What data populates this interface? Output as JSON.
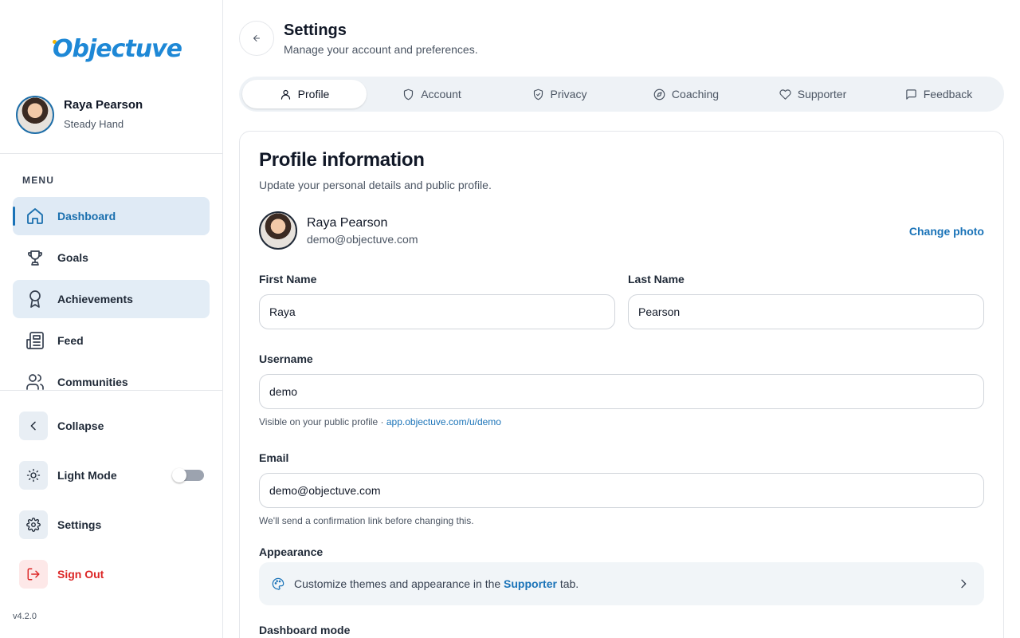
{
  "sidebar": {
    "logo": "Objectuve",
    "user": {
      "name": "Raya Pearson",
      "title": "Steady Hand"
    },
    "menu_label": "MENU",
    "items": [
      {
        "label": "Dashboard",
        "icon": "home-icon",
        "active": true
      },
      {
        "label": "Goals",
        "icon": "trophy-icon"
      },
      {
        "label": "Achievements",
        "icon": "award-icon"
      },
      {
        "label": "Feed",
        "icon": "newspaper-icon"
      },
      {
        "label": "Communities",
        "icon": "users-icon"
      }
    ],
    "collapse_label": "Collapse",
    "light_mode_label": "Light Mode",
    "light_mode_on": false,
    "settings_label": "Settings",
    "sign_out_label": "Sign Out",
    "version": "v4.2.0"
  },
  "header": {
    "title": "Settings",
    "subtitle": "Manage your account and preferences."
  },
  "tabs": [
    {
      "label": "Profile",
      "icon": "user-icon",
      "active": true
    },
    {
      "label": "Account",
      "icon": "shield-icon"
    },
    {
      "label": "Privacy",
      "icon": "shield-check-icon"
    },
    {
      "label": "Coaching",
      "icon": "compass-icon"
    },
    {
      "label": "Supporter",
      "icon": "heart-icon"
    },
    {
      "label": "Feedback",
      "icon": "message-icon"
    }
  ],
  "profile": {
    "title": "Profile information",
    "subtitle": "Update your personal details and public profile.",
    "name": "Raya Pearson",
    "email": "demo@objectuve.com",
    "change_photo": "Change photo",
    "first_name_label": "First Name",
    "first_name_value": "Raya",
    "last_name_label": "Last Name",
    "last_name_value": "Pearson",
    "username_label": "Username",
    "username_value": "demo",
    "username_hint": "Visible on your public profile · ",
    "username_link": "app.objectuve.com/u/demo",
    "email_label": "Email",
    "email_value": "demo@objectuve.com",
    "email_hint": "We'll send a confirmation link before changing this.",
    "appearance_label": "Appearance",
    "appearance_text_before": "Customize themes and appearance in the ",
    "appearance_link": "Supporter",
    "appearance_text_after": " tab.",
    "dashboard_mode_label": "Dashboard mode"
  },
  "colors": {
    "accent": "#1a73b8",
    "active_bg": "#dfeaf5",
    "danger": "#dc2626"
  }
}
